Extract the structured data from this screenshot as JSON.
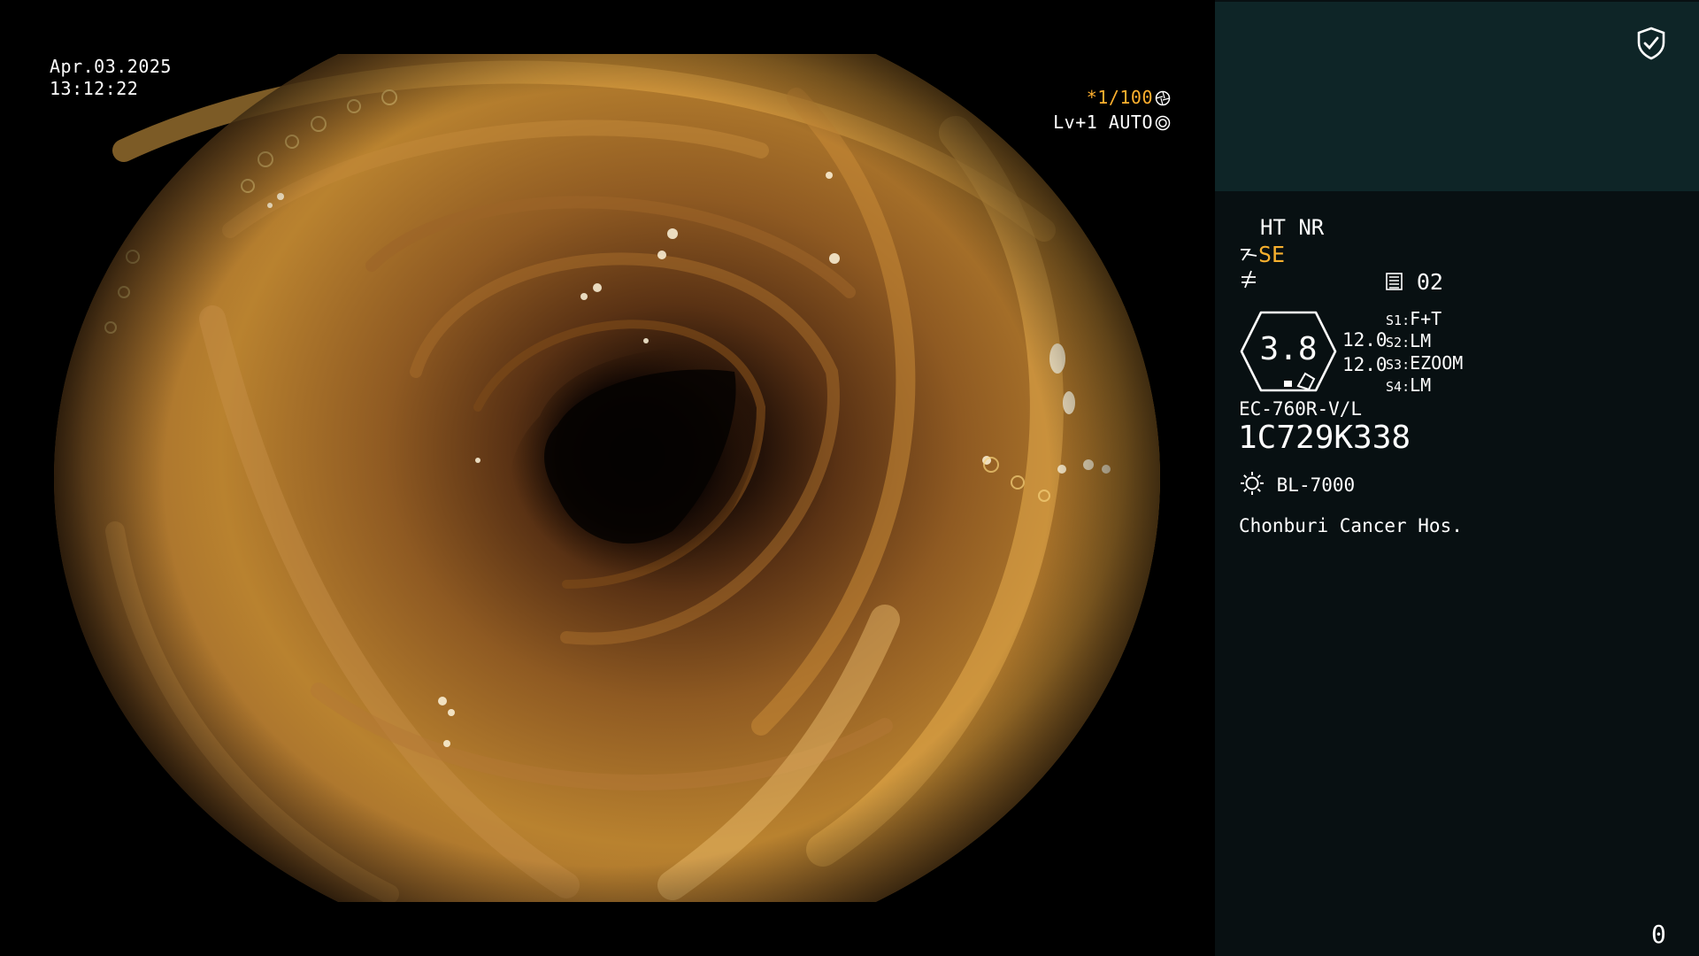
{
  "osd": {
    "date": "Apr.03.2025",
    "time": "13:12:22",
    "shutter": "*1/100",
    "level": "Lv+1 AUTO"
  },
  "panel": {
    "ht_nr": "HT NR",
    "structure_enhance": "SE",
    "mode_number": "02",
    "gauge_value": "3.8",
    "iris_1": "12.0",
    "iris_2": "12.0",
    "switches": [
      {
        "key": "S1",
        "value": "F+T"
      },
      {
        "key": "S2",
        "value": "LM"
      },
      {
        "key": "S3",
        "value": "EZOOM"
      },
      {
        "key": "S4",
        "value": "LM"
      }
    ],
    "scope_model": "EC-760R-V/L",
    "serial": "1C729K338",
    "light_source": "BL-7000",
    "hospital": "Chonburi Cancer Hos.",
    "counter": "0"
  },
  "colors": {
    "panel_bg": "#081012",
    "panel_top_bg": "#0e2527",
    "highlight": "#f7b02e"
  },
  "icons": [
    "shutter-icon",
    "auto-iris-icon",
    "shield-check-icon",
    "structure-enhance-icon",
    "color-enhance-icon",
    "memory-icon",
    "light-source-icon"
  ]
}
